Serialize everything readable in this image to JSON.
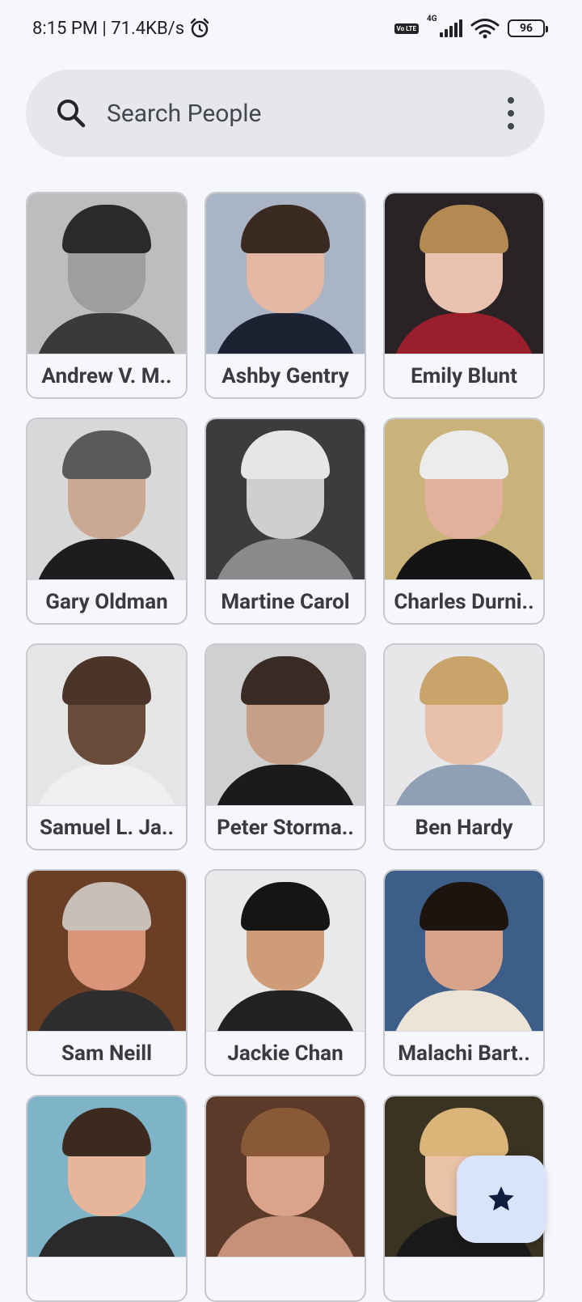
{
  "status_bar": {
    "time_speed": "8:15 PM | 71.4KB/s",
    "volte": "Vo LTE",
    "network": "4G",
    "battery": "96"
  },
  "search": {
    "placeholder": "Search People"
  },
  "people": [
    {
      "name": "Andrew V. M..",
      "bg": "#bdbdbd",
      "skin": "#9e9e9e",
      "hair": "#2a2a2a",
      "body": "#3a3a3a"
    },
    {
      "name": "Ashby Gentry",
      "bg": "#a9b4c4",
      "skin": "#e4b8a2",
      "hair": "#3b2a22",
      "body": "#1d2233"
    },
    {
      "name": "Emily Blunt",
      "bg": "#2a2326",
      "skin": "#e8c2ae",
      "hair": "#b58a52",
      "body": "#9b1e2c"
    },
    {
      "name": "Gary Oldman",
      "bg": "#d8d8d8",
      "skin": "#caa894",
      "hair": "#5a5a5a",
      "body": "#1d1d1d"
    },
    {
      "name": "Martine Carol",
      "bg": "#3c3c3c",
      "skin": "#cfcfcf",
      "hair": "#e6e6e6",
      "body": "#8a8a8a"
    },
    {
      "name": "Charles Durni..",
      "bg": "#c9b37a",
      "skin": "#e2b09c",
      "hair": "#ececec",
      "body": "#141414"
    },
    {
      "name": "Samuel L. Ja..",
      "bg": "#e5e5e5",
      "skin": "#6a4a38",
      "hair": "#4b3428",
      "body": "#efefef"
    },
    {
      "name": "Peter Storma..",
      "bg": "#cfd0d0",
      "skin": "#c79e86",
      "hair": "#3a2b24",
      "body": "#1b1b1b"
    },
    {
      "name": "Ben Hardy",
      "bg": "#e7e7ea",
      "skin": "#e9c1aa",
      "hair": "#c9a46a",
      "body": "#8fa0b4"
    },
    {
      "name": "Sam Neill",
      "bg": "#6b3e26",
      "skin": "#d8957a",
      "hair": "#c8c0b8",
      "body": "#2e2e2e"
    },
    {
      "name": "Jackie Chan",
      "bg": "#e9e9e9",
      "skin": "#cf9c78",
      "hair": "#151515",
      "body": "#222222"
    },
    {
      "name": "Malachi Bart..",
      "bg": "#3e5e8a",
      "skin": "#d7a48a",
      "hair": "#1d1410",
      "body": "#ece4d6"
    },
    {
      "name": "",
      "bg": "#7fb3c8",
      "skin": "#e7b69a",
      "hair": "#3d2a1e",
      "body": "#2a2a2a"
    },
    {
      "name": "",
      "bg": "#5c3a2a",
      "skin": "#dba48a",
      "hair": "#8a5a38",
      "body": "#c79078"
    },
    {
      "name": "",
      "bg": "#3a3322",
      "skin": "#e9c2a8",
      "hair": "#d9b57a",
      "body": "#1a1a1a"
    }
  ],
  "colors": {
    "background": "#f6f7fc",
    "search_bg": "#e6e7ec",
    "fab_bg": "#d9e3fb",
    "fab_icon": "#0f1e3d"
  },
  "fab": {
    "icon": "star-icon"
  }
}
